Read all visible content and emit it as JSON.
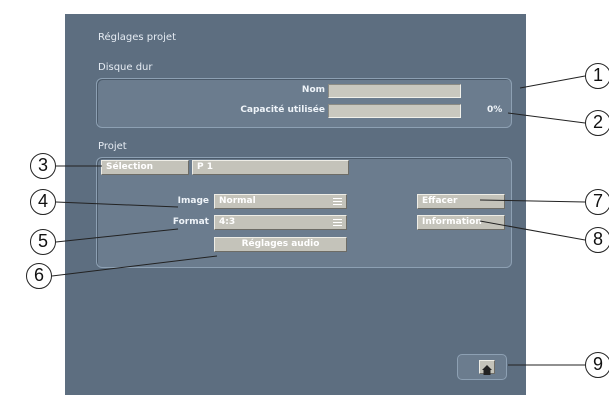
{
  "window": {
    "title": "Réglages projet"
  },
  "hard_disk": {
    "section_label": "Disque dur",
    "name_label": "Nom",
    "name_value": "",
    "capacity_label": "Capacité utilisée",
    "capacity_percent": "0%",
    "capacity_fraction": 0
  },
  "project": {
    "section_label": "Projet",
    "selection_button": "Sélection",
    "selection_value": "P 1",
    "image_label": "Image",
    "image_value": "Normal",
    "format_label": "Format",
    "format_value": "4:3",
    "audio_button": "Réglages audio",
    "delete_button": "Effacer",
    "info_button": "Information"
  },
  "home": {
    "icon": "home-icon"
  },
  "callouts": [
    "1",
    "2",
    "3",
    "4",
    "5",
    "6",
    "7",
    "8",
    "9"
  ]
}
